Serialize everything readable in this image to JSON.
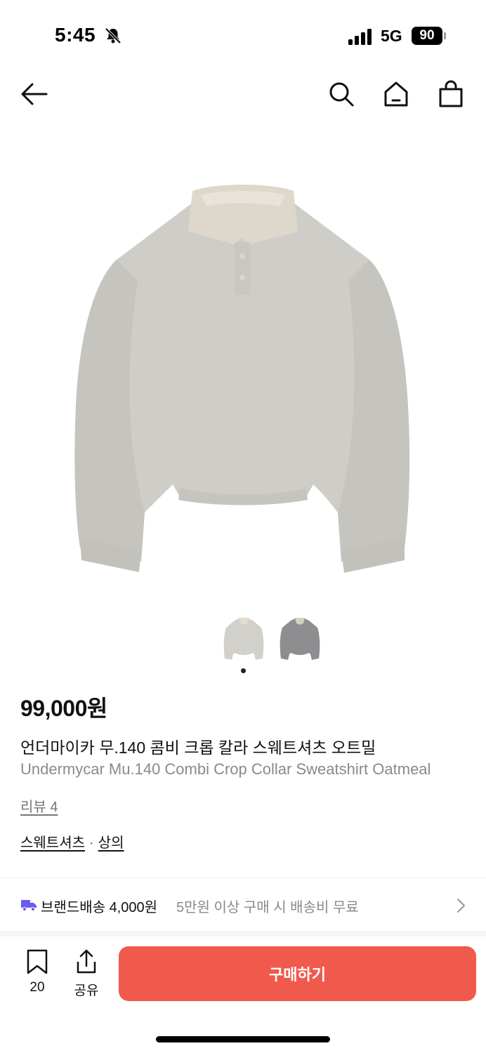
{
  "status_bar": {
    "time": "5:45",
    "network": "5G",
    "battery": "90"
  },
  "nav": {
    "back_icon": "arrow-left-icon",
    "search_icon": "search-icon",
    "home_icon": "home-icon",
    "bag_icon": "shopping-bag-icon"
  },
  "gallery": {
    "images": [
      {
        "name": "sweatshirt-oatmeal",
        "color": "#cfcdc8"
      },
      {
        "name": "sweatshirt-grey",
        "color": "#8e8e90"
      }
    ],
    "active_index": 0
  },
  "product": {
    "price": "99,000원",
    "name_ko": "언더마이카 무.140 콤비 크롭 칼라 스웨트셔츠 오트밀",
    "name_en": "Undermycar Mu.140 Combi Crop Collar Sweatshirt Oatmeal",
    "review": "리뷰 4",
    "category_1": "스웨트셔츠",
    "category_sep": "·",
    "category_2": "상의"
  },
  "shipping": {
    "label": "브랜드배송",
    "fee": "4,000원",
    "note": "5만원 이상 구매 시 배송비 무료",
    "truck_color": "#6b5cf0"
  },
  "action_bar": {
    "save_count": "20",
    "share_label": "공유",
    "buy_label": "구매하기",
    "buy_color": "#ef5a4c"
  }
}
